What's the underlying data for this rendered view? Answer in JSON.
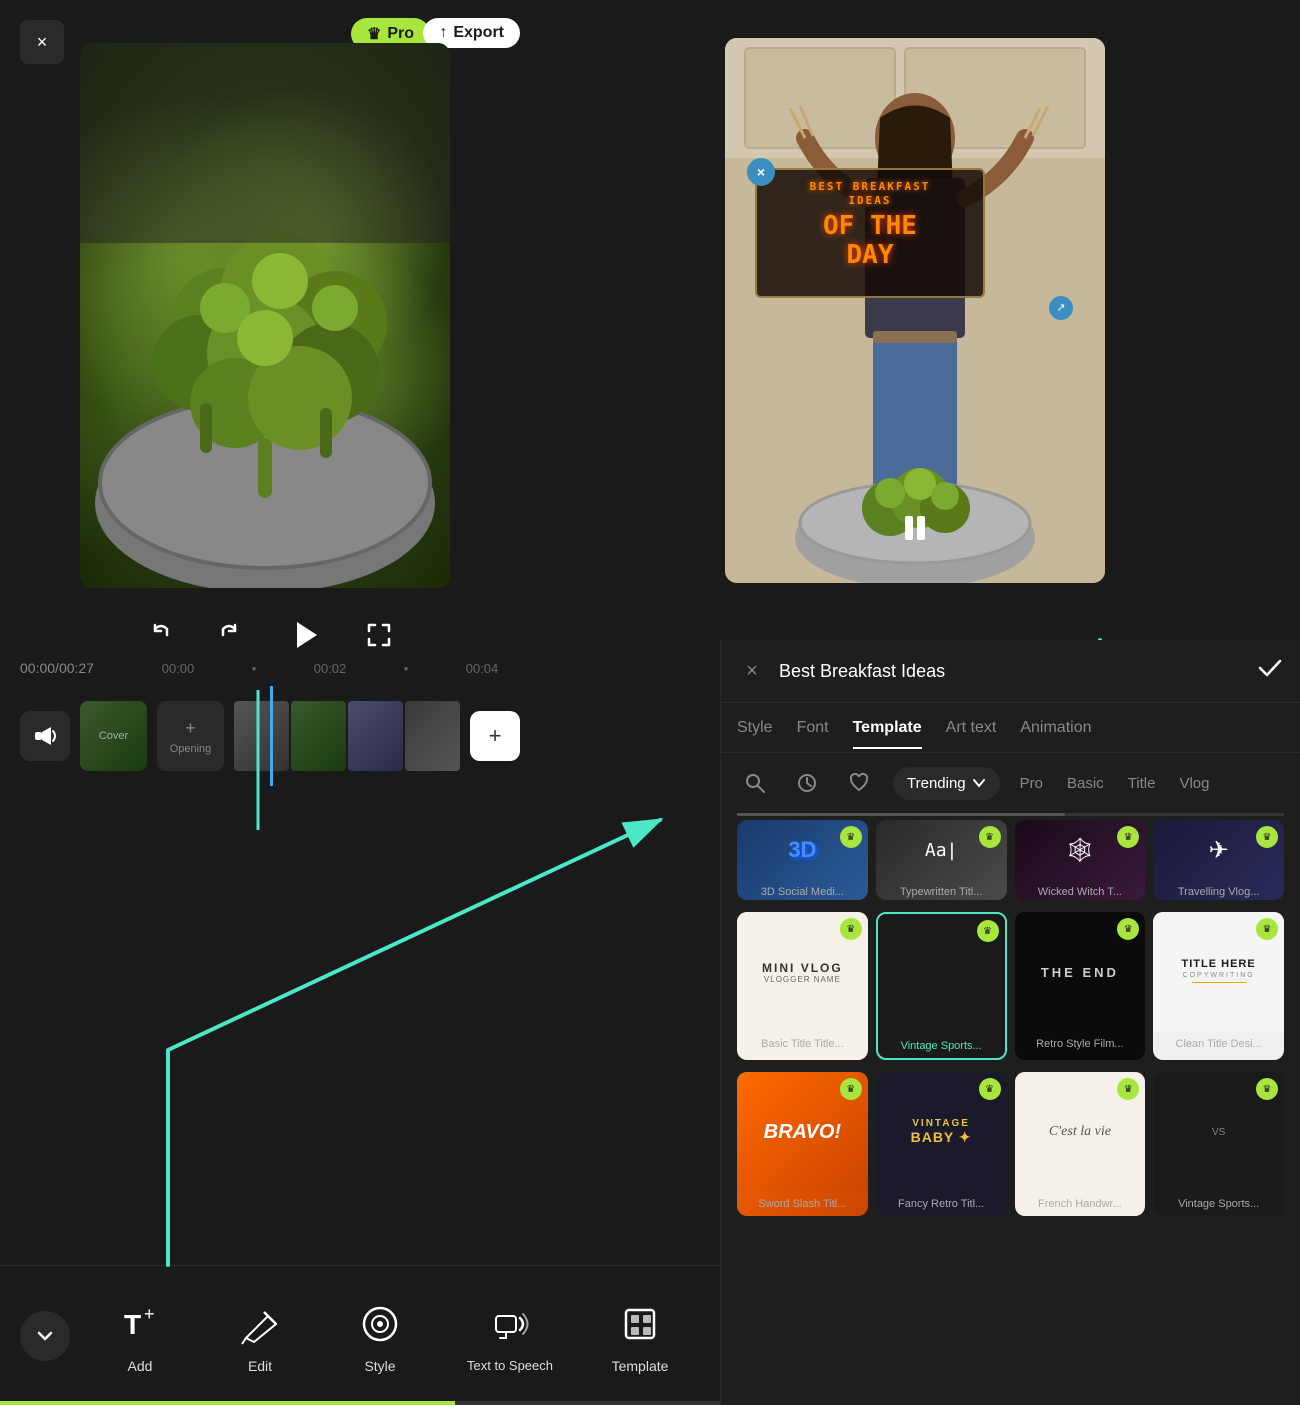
{
  "header": {
    "close_label": "×",
    "pro_label": "Pro",
    "export_label": "Export",
    "crown": "♛"
  },
  "transport": {
    "time_current": "00:00",
    "time_total": "00:27",
    "markers": [
      "00:00",
      "00:02",
      "00:04"
    ],
    "undo_icon": "↩",
    "redo_icon": "↪",
    "play_icon": "▶",
    "fullscreen_icon": "⛶",
    "pause_icon": "⏸"
  },
  "timeline": {
    "cover_label": "Cover",
    "opening_label": "Opening",
    "plus_icon": "+",
    "add_plus": "+"
  },
  "toolbar": {
    "items": [
      {
        "id": "add",
        "label": "Add",
        "icon": "T+"
      },
      {
        "id": "edit",
        "label": "Edit",
        "icon": "✎"
      },
      {
        "id": "style",
        "label": "Style",
        "icon": "◎"
      },
      {
        "id": "text-to-speech",
        "label": "Text to Speech",
        "icon": "☁"
      },
      {
        "id": "template",
        "label": "Template",
        "icon": "⊡"
      }
    ],
    "chevron": "∨"
  },
  "panel": {
    "close_icon": "×",
    "search_value": "Best Breakfast Ideas",
    "confirm_icon": "✓",
    "tabs": [
      {
        "id": "style",
        "label": "Style",
        "active": false
      },
      {
        "id": "font",
        "label": "Font",
        "active": false
      },
      {
        "id": "template",
        "label": "Template",
        "active": true
      },
      {
        "id": "art-text",
        "label": "Art text",
        "active": false
      },
      {
        "id": "animation",
        "label": "Animation",
        "active": false
      }
    ],
    "filters": {
      "trending_label": "Trending",
      "pro_label": "Pro",
      "basic_label": "Basic",
      "title_label": "Title",
      "vlog_label": "Vlog"
    },
    "templates_row1": [
      {
        "id": "3d-social",
        "label": "3D Social Medi...",
        "bg": "tmpl-3d",
        "text": "3D",
        "has_pro": true
      },
      {
        "id": "typewritten",
        "label": "Typewritten Titl...",
        "bg": "tmpl-typewriter",
        "text": "Aa",
        "has_pro": true
      },
      {
        "id": "wicked-witch",
        "label": "Wicked Witch T...",
        "bg": "tmpl-witch",
        "text": "🕸",
        "has_pro": true
      },
      {
        "id": "travelling-vlog",
        "label": "Travelling Vlog...",
        "bg": "tmpl-vlog",
        "text": "✈",
        "has_pro": true
      }
    ],
    "templates_row2": [
      {
        "id": "mini-vlog",
        "label": "Basic Title Title...",
        "bg": "tmpl-minivlog",
        "text": "MINI VLOG",
        "has_pro": true,
        "text_color": "#333"
      },
      {
        "id": "vintage-sports",
        "label": "Vintage Sports...",
        "bg": "tmpl-vintage-sports",
        "text": "",
        "has_pro": true,
        "selected": true
      },
      {
        "id": "retro-film",
        "label": "Retro Style Film...",
        "bg": "tmpl-retro",
        "text": "THE END",
        "has_pro": true
      },
      {
        "id": "clean-title",
        "label": "Clean Title Desi...",
        "bg": "tmpl-clean",
        "text": "TITLE HERE",
        "has_pro": true,
        "text_color": "#1a1a1a"
      }
    ],
    "templates_row3": [
      {
        "id": "sword-slash",
        "label": "Sword Slash Titl...",
        "bg": "tmpl-bravo",
        "text": "BRAVO!",
        "has_pro": true
      },
      {
        "id": "fancy-retro",
        "label": "Fancy Retro Titl...",
        "bg": "tmpl-vintage-baby",
        "text": "VINTAGE BABY",
        "has_pro": true
      },
      {
        "id": "french-handwr",
        "label": "French Handwr...",
        "bg": "tmpl-cest",
        "text": "C'est la vie",
        "has_pro": true,
        "text_color": "#555"
      },
      {
        "id": "vintage-sports3",
        "label": "Vintage Sports...",
        "bg": "tmpl-vintage-sports2",
        "text": "",
        "has_pro": true
      }
    ],
    "overlay_text_line1": "BEST BREAKFAST",
    "overlay_text_line2": "IDEAS",
    "overlay_text_main1": "OF THE",
    "overlay_text_main2": "DAY"
  },
  "colors": {
    "accent_teal": "#4ae8c8",
    "accent_green": "#a8e63d",
    "background": "#1a1a1a",
    "panel_bg": "#1e1e1e",
    "card_bg": "#2a2a2a"
  }
}
